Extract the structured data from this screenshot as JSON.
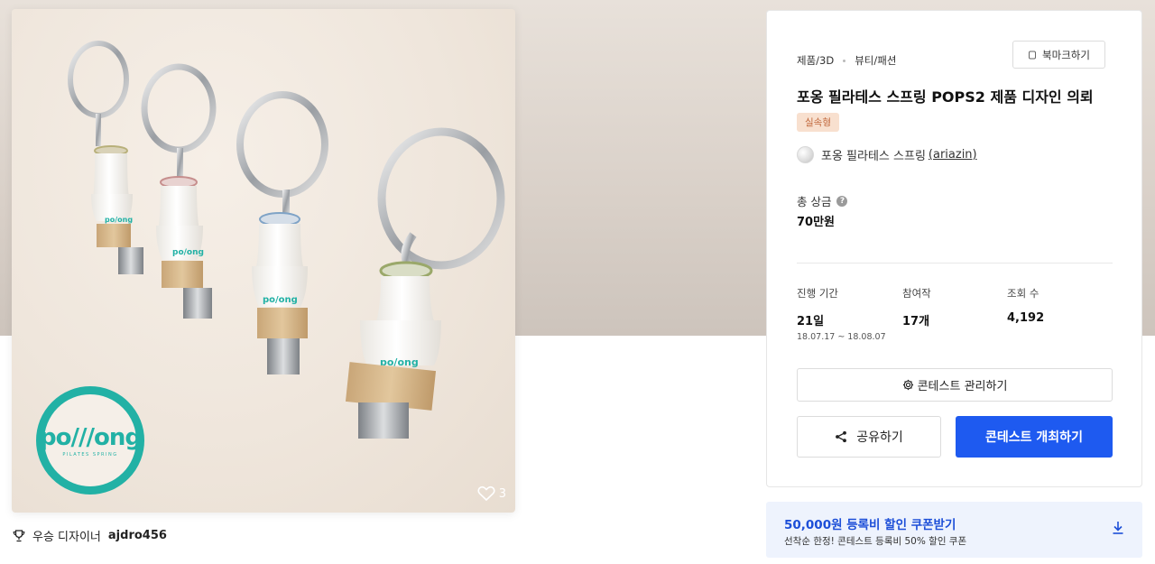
{
  "product": {
    "like_count": "3",
    "logo_word": "po///ong",
    "logo_sub": "PILATES SPRING",
    "winner_label": "우승 디자이너",
    "winner_name": "ajdro456"
  },
  "contest": {
    "category_main": "제품/3D",
    "category_sub": "뷰티/패션",
    "bookmark_label": "북마크하기",
    "title": "포옹 필라테스 스프링 POPS2 제품 디자인 의뢰",
    "type_badge": "실속형",
    "host_name": "포옹 필라테스 스프링",
    "host_id": "(ariazin)",
    "prize_label": "총 상금",
    "prize_help": "?",
    "prize_value": "70만원",
    "stats": {
      "period_label": "진행 기간",
      "period_value": "21일",
      "period_range": "18.07.17 ~ 18.08.07",
      "entries_label": "참여작",
      "entries_value": "17개",
      "views_label": "조회 수",
      "views_value": "4,192"
    },
    "manage_label": "콘테스트 관리하기",
    "share_label": "공유하기",
    "host_contest_label": "콘테스트 개최하기"
  },
  "coupon": {
    "title": "50,000원 등록비 할인 쿠폰받기",
    "subtitle": "선착순 한정! 콘테스트 등록비 50% 할인 쿠폰"
  },
  "colors": {
    "accent": "#1e5af0",
    "logo_teal": "#22b1a5",
    "badge_bg": "#f8e0cf",
    "badge_text": "#c0663a",
    "coupon_bg": "#eef3fd"
  },
  "icons": [
    "bookmark-icon",
    "help-icon",
    "gear-icon",
    "share-icon",
    "download-icon",
    "heart-icon",
    "trophy-icon"
  ]
}
